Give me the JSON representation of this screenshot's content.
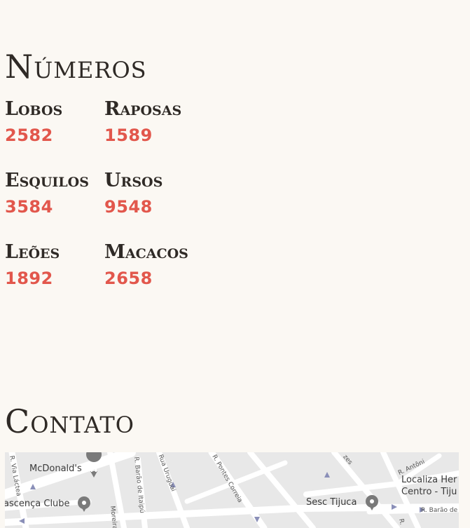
{
  "numbers": {
    "title": "Números",
    "items": [
      {
        "name": "Lobos",
        "value": "2582"
      },
      {
        "name": "Raposas",
        "value": "1589"
      },
      {
        "name": "Esquilos",
        "value": "3584"
      },
      {
        "name": "Ursos",
        "value": "9548"
      },
      {
        "name": "Leões",
        "value": "1892"
      },
      {
        "name": "Macacos",
        "value": "2658"
      }
    ]
  },
  "contact": {
    "title": "Contato",
    "map": {
      "places": {
        "mcdonalds": "McDonald's",
        "renascenca": "ascença Clube",
        "sesc": "Sesc Tijuca",
        "localiza_line1": "Localiza Her",
        "localiza_line2": "Centro - Tiju"
      },
      "streets": {
        "via_lactea": "R. Via Láctea",
        "barao_itaipu": "R. Barão de Itaipú",
        "uruguai": "Rua Uruguai",
        "pontes_correia": "R. Pontes Correia",
        "moreira": "Moreira",
        "antonio": "R. Antôni",
        "barao_de": "R. Barão de",
        "zes": "zes",
        "r_dot": "R."
      },
      "colors": {
        "background": "#e8e8e8",
        "road": "#ffffff",
        "pin": "#7a7a7a",
        "poi_blue": "#4d86d0"
      }
    }
  },
  "theme": {
    "accent": "#e2574c",
    "text": "#2f2a26",
    "page_bg": "#fbf8f3"
  }
}
